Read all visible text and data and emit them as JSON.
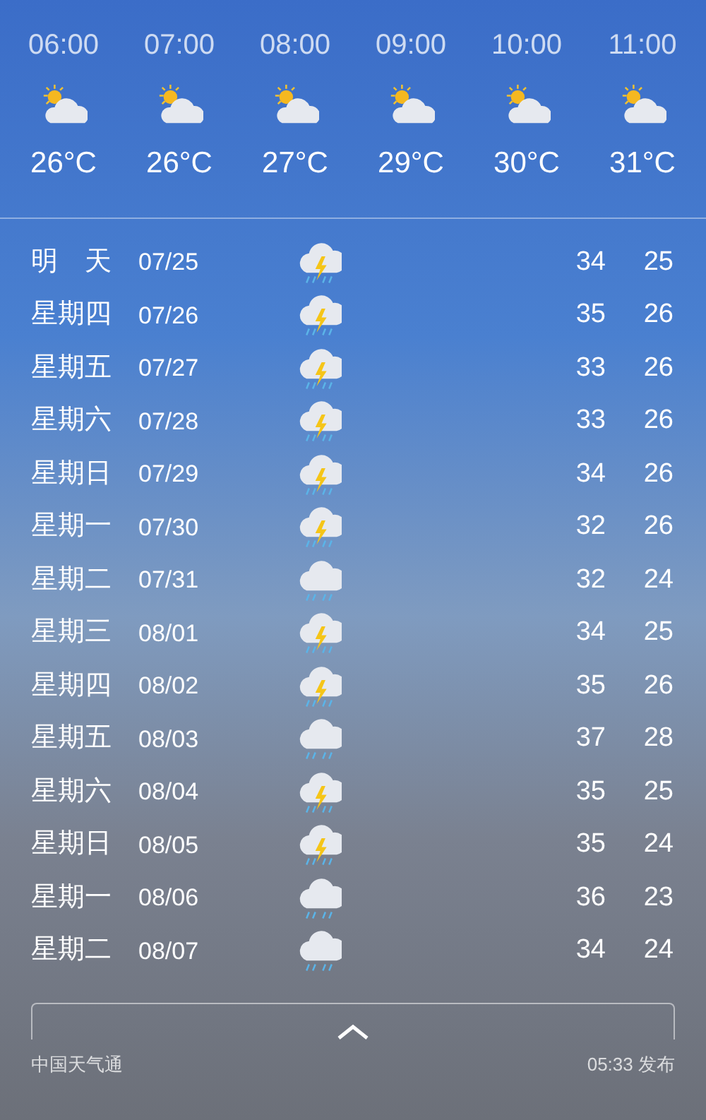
{
  "hourly": [
    {
      "time": "06:00",
      "kind": "partly_cloudy",
      "temp": "26°C"
    },
    {
      "time": "07:00",
      "kind": "partly_cloudy",
      "temp": "26°C"
    },
    {
      "time": "08:00",
      "kind": "partly_cloudy",
      "temp": "27°C"
    },
    {
      "time": "09:00",
      "kind": "partly_cloudy",
      "temp": "29°C"
    },
    {
      "time": "10:00",
      "kind": "partly_cloudy",
      "temp": "30°C"
    },
    {
      "time": "11:00",
      "kind": "partly_cloudy",
      "temp": "31°C"
    }
  ],
  "daily": [
    {
      "day": "明　天",
      "date": "07/25",
      "kind": "thunderstorm",
      "high": "34",
      "low": "25"
    },
    {
      "day": "星期四",
      "date": "07/26",
      "kind": "thunderstorm",
      "high": "35",
      "low": "26"
    },
    {
      "day": "星期五",
      "date": "07/27",
      "kind": "thunderstorm",
      "high": "33",
      "low": "26"
    },
    {
      "day": "星期六",
      "date": "07/28",
      "kind": "thunderstorm",
      "high": "33",
      "low": "26"
    },
    {
      "day": "星期日",
      "date": "07/29",
      "kind": "thunderstorm",
      "high": "34",
      "low": "26"
    },
    {
      "day": "星期一",
      "date": "07/30",
      "kind": "thunderstorm",
      "high": "32",
      "low": "26"
    },
    {
      "day": "星期二",
      "date": "07/31",
      "kind": "rain",
      "high": "32",
      "low": "24"
    },
    {
      "day": "星期三",
      "date": "08/01",
      "kind": "thunderstorm",
      "high": "34",
      "low": "25"
    },
    {
      "day": "星期四",
      "date": "08/02",
      "kind": "thunderstorm",
      "high": "35",
      "low": "26"
    },
    {
      "day": "星期五",
      "date": "08/03",
      "kind": "rain",
      "high": "37",
      "low": "28"
    },
    {
      "day": "星期六",
      "date": "08/04",
      "kind": "thunderstorm",
      "high": "35",
      "low": "25"
    },
    {
      "day": "星期日",
      "date": "08/05",
      "kind": "thunderstorm",
      "high": "35",
      "low": "24"
    },
    {
      "day": "星期一",
      "date": "08/06",
      "kind": "rain",
      "high": "36",
      "low": "23"
    },
    {
      "day": "星期二",
      "date": "08/07",
      "kind": "rain",
      "high": "34",
      "low": "24"
    }
  ],
  "footer": {
    "source": "中国天气通",
    "published": "05:33 发布"
  }
}
